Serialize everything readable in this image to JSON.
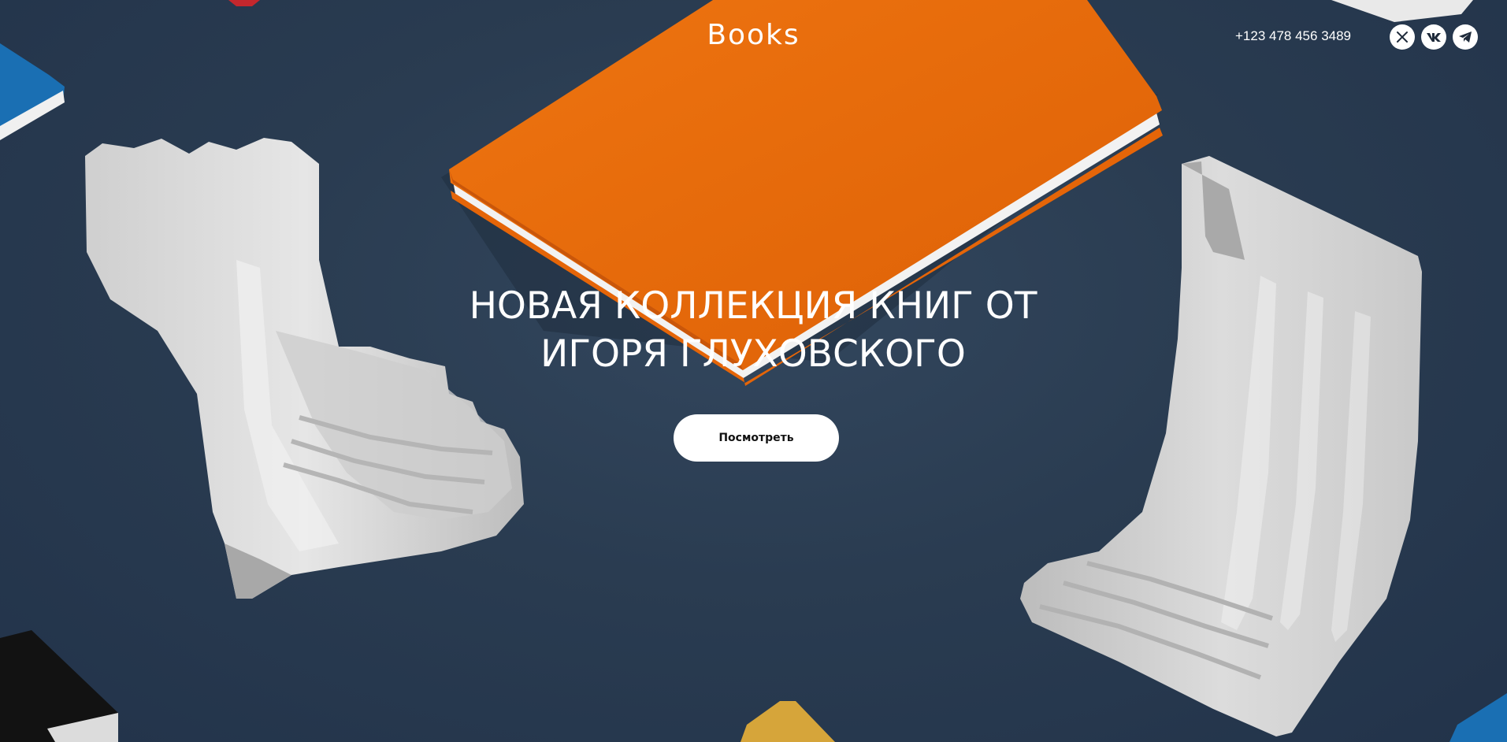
{
  "header": {
    "logo": "Books",
    "phone": "+123 478 456 3489",
    "social_links": [
      {
        "icon": "x-twitter-icon"
      },
      {
        "icon": "vk-icon"
      },
      {
        "icon": "telegram-icon"
      }
    ]
  },
  "hero": {
    "headline_line1": "НОВАЯ КОЛЛЕКЦИЯ КНИГ ОТ",
    "headline_line2": "ИГОРЯ ГЛУХОВСКОГО",
    "cta_label": "Посмотреть",
    "background_image": "books-and-ceramic-bookends-photo"
  },
  "colors": {
    "background": "#2b3d52",
    "book_orange": "#e8690a",
    "ceramic": "#d9d9d9",
    "text": "#ffffff",
    "button_bg": "#ffffff",
    "button_text": "#111111"
  }
}
